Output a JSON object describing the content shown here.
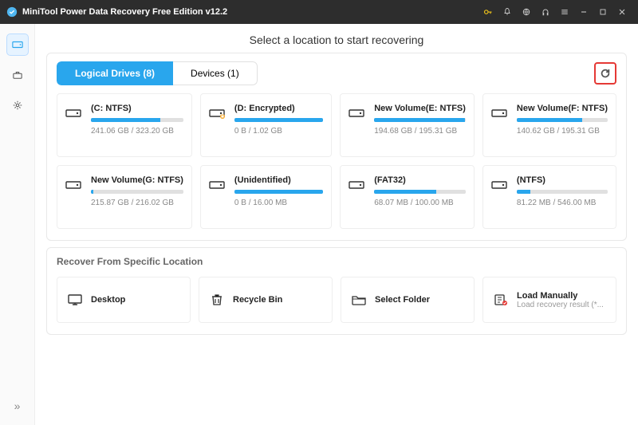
{
  "titlebar": {
    "app_title": "MiniTool Power Data Recovery Free Edition v12.2"
  },
  "heading": "Select a location to start recovering",
  "tabs": {
    "logical": "Logical Drives (8)",
    "devices": "Devices (1)"
  },
  "drives": [
    {
      "name": "(C: NTFS)",
      "size": "241.06 GB / 323.20 GB",
      "fill": 75,
      "locked": false
    },
    {
      "name": "(D: Encrypted)",
      "size": "0 B / 1.02 GB",
      "fill": 100,
      "locked": true
    },
    {
      "name": "New Volume(E: NTFS)",
      "size": "194.68 GB / 195.31 GB",
      "fill": 99,
      "locked": false
    },
    {
      "name": "New Volume(F: NTFS)",
      "size": "140.62 GB / 195.31 GB",
      "fill": 72,
      "locked": false
    },
    {
      "name": "New Volume(G: NTFS)",
      "size": "215.87 GB / 216.02 GB",
      "fill": 3,
      "locked": false
    },
    {
      "name": "(Unidentified)",
      "size": "0 B / 16.00 MB",
      "fill": 100,
      "locked": false
    },
    {
      "name": "(FAT32)",
      "size": "68.07 MB / 100.00 MB",
      "fill": 68,
      "locked": false
    },
    {
      "name": "(NTFS)",
      "size": "81.22 MB / 546.00 MB",
      "fill": 15,
      "locked": false
    }
  ],
  "recover_section": {
    "title": "Recover From Specific Location"
  },
  "locations": [
    {
      "name": "Desktop",
      "sub": "",
      "icon": "desktop"
    },
    {
      "name": "Recycle Bin",
      "sub": "",
      "icon": "trash"
    },
    {
      "name": "Select Folder",
      "sub": "",
      "icon": "folder"
    },
    {
      "name": "Load Manually",
      "sub": "Load recovery result (*...",
      "icon": "load"
    }
  ]
}
